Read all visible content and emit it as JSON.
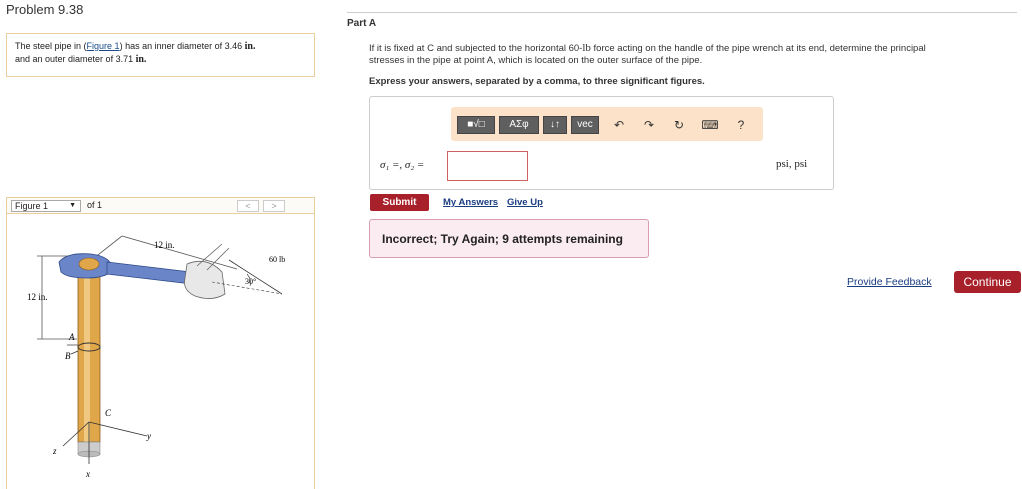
{
  "problem": {
    "title": "Problem 9.38"
  },
  "description": {
    "pre": "The steel pipe in (",
    "figure_link": "Figure 1",
    "mid": ") has an inner diameter of 3.46 ",
    "unit1": "in.",
    "line2": "and an outer diameter of 3.71 ",
    "unit2": "in."
  },
  "figure_nav": {
    "selected": "Figure 1",
    "of_text": "of 1",
    "prev": "<",
    "next": ">"
  },
  "figure": {
    "label_12in_top": "12 in.",
    "label_60lb": "60 lb",
    "label_30deg": "30°",
    "label_12in_side": "12 in.",
    "label_A": "A",
    "label_B": "B",
    "label_C": "C",
    "label_y": "y",
    "label_z": "z",
    "label_x": "x"
  },
  "part": {
    "title": "Part A",
    "question_1": "If it is fixed at C and subjected to the horizontal 60-",
    "question_unit": "lb",
    "question_2": " force acting on the handle of the pipe wrench at its end, determine the principal",
    "question_3": "stresses in the pipe at point A, which is located on the outer surface of the pipe.",
    "instruction": "Express your answers, separated by a comma, to three significant figures."
  },
  "toolbar": {
    "templates": "■√□",
    "symbols": "ΑΣφ",
    "arrows": "↓↑",
    "vec": "vec",
    "undo": "↶",
    "redo": "↷",
    "reset": "↻",
    "keyboard": "⌨",
    "help": "?"
  },
  "answer": {
    "label": "σ₁ =, σ₂ =",
    "value": "",
    "units": "psi, psi"
  },
  "actions": {
    "submit": "Submit",
    "my_answers": "My Answers",
    "give_up": "Give Up"
  },
  "feedback": {
    "text": "Incorrect; Try Again; 9 attempts remaining"
  },
  "footer": {
    "provide_feedback": "Provide Feedback",
    "continue": "Continue"
  }
}
